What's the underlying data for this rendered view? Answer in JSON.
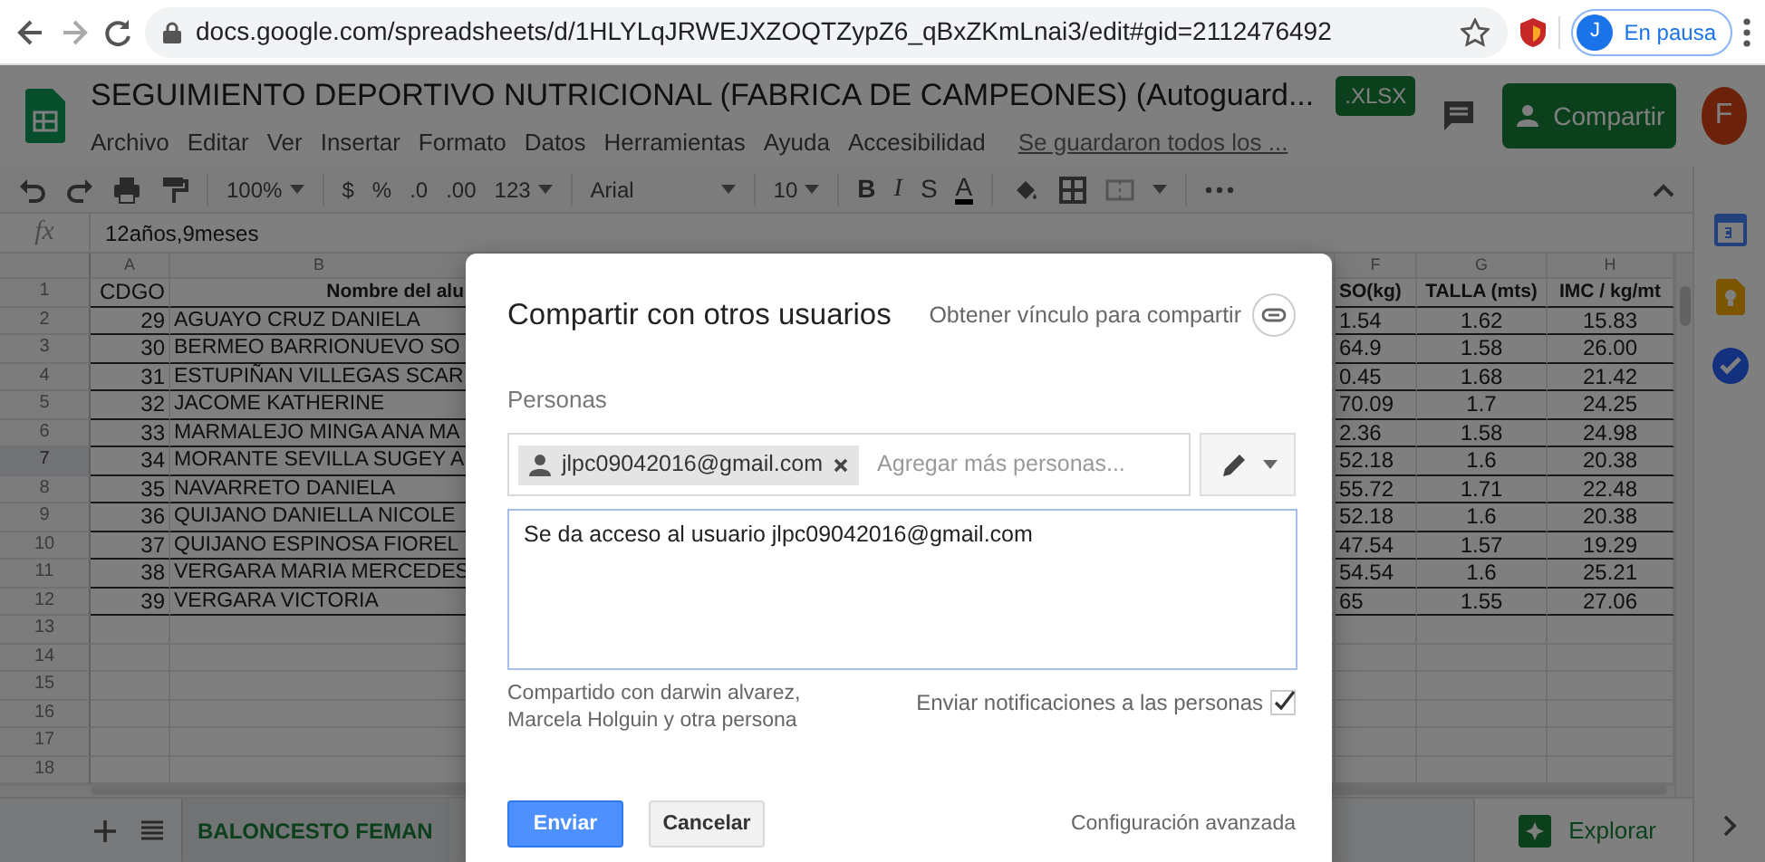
{
  "browser": {
    "address": "docs.google.com/spreadsheets/d/1HLYLqJRWEJXZOQTZypZ6_qBxZKmLnai3/edit#gid=2112476492",
    "profile_initial": "J",
    "profile_status": "En pausa"
  },
  "app": {
    "title": "SEGUIMIENTO DEPORTIVO NUTRICIONAL (FABRICA DE CAMPEONES) (Autoguard...",
    "file_badge": ".XLSX",
    "menu": [
      "Archivo",
      "Editar",
      "Ver",
      "Insertar",
      "Formato",
      "Datos",
      "Herramientas",
      "Ayuda",
      "Accesibilidad"
    ],
    "save_status": "Se guardaron todos los ...",
    "share_button": "Compartir",
    "avatar_initial": "F"
  },
  "toolbar": {
    "zoom": "100%",
    "currency": "$",
    "percent": "%",
    "decimals_less": ".0",
    "decimals_more": ".00",
    "number_format": "123",
    "font": "Arial",
    "font_size": "10",
    "bold": "B",
    "italic": "I",
    "strikethrough": "S",
    "text_color": "A"
  },
  "formula_bar": {
    "fx": "fx",
    "value": "12años,9meses"
  },
  "sheet": {
    "columns": [
      "A",
      "B",
      "F",
      "G",
      "H"
    ],
    "rows": [
      {
        "number": "1",
        "kind": "header",
        "selected": false,
        "cells": [
          "CDGO",
          "Nombre del alu",
          "SO(kg)",
          "TALLA (mts)",
          "IMC /  kg/mt"
        ]
      },
      {
        "number": "2",
        "kind": "data",
        "selected": false,
        "cells": [
          "29",
          "AGUAYO CRUZ DANIELA",
          "1.54",
          "1.62",
          "15.83"
        ]
      },
      {
        "number": "3",
        "kind": "data",
        "selected": false,
        "cells": [
          "30",
          "BERMEO BARRIONUEVO SO",
          "64.9",
          "1.58",
          "26.00"
        ]
      },
      {
        "number": "4",
        "kind": "data",
        "selected": false,
        "cells": [
          "31",
          "ESTUPIÑAN VILLEGAS SCAR",
          "0.45",
          "1.68",
          "21.42"
        ]
      },
      {
        "number": "5",
        "kind": "data",
        "selected": false,
        "cells": [
          "32",
          "JACOME KATHERINE",
          "70.09",
          "1.7",
          "24.25"
        ]
      },
      {
        "number": "6",
        "kind": "data",
        "selected": false,
        "cells": [
          "33",
          "MARMALEJO MINGA ANA MA",
          "2.36",
          "1.58",
          "24.98"
        ]
      },
      {
        "number": "7",
        "kind": "data",
        "selected": true,
        "cells": [
          "34",
          "MORANTE SEVILLA SUGEY A",
          "52.18",
          "1.6",
          "20.38"
        ]
      },
      {
        "number": "8",
        "kind": "data",
        "selected": false,
        "cells": [
          "35",
          "NAVARRETO DANIELA",
          "55.72",
          "1.71",
          "22.48"
        ]
      },
      {
        "number": "9",
        "kind": "data",
        "selected": false,
        "cells": [
          "36",
          "QUIJANO DANIELLA NICOLE",
          "52.18",
          "1.6",
          "20.38"
        ]
      },
      {
        "number": "10",
        "kind": "data",
        "selected": false,
        "cells": [
          "37",
          "QUIJANO ESPINOSA FIOREL",
          "47.54",
          "1.57",
          "19.29"
        ]
      },
      {
        "number": "11",
        "kind": "data",
        "selected": false,
        "cells": [
          "38",
          "VERGARA MARIA MERCEDES",
          "54.54",
          "1.6",
          "25.21"
        ]
      },
      {
        "number": "12",
        "kind": "data",
        "selected": false,
        "cells": [
          "39",
          "VERGARA VICTORIA",
          "65",
          "1.55",
          "27.06"
        ]
      },
      {
        "number": "13",
        "kind": "empty",
        "selected": false
      },
      {
        "number": "14",
        "kind": "empty",
        "selected": false
      },
      {
        "number": "15",
        "kind": "empty",
        "selected": false
      },
      {
        "number": "16",
        "kind": "empty",
        "selected": false
      },
      {
        "number": "17",
        "kind": "empty",
        "selected": false
      },
      {
        "number": "18",
        "kind": "empty",
        "selected": false
      }
    ],
    "tab": "BALONCESTO FEMAN",
    "explore": "Explorar"
  },
  "dialog": {
    "title": "Compartir con otros usuarios",
    "link": "Obtener vínculo para compartir",
    "section": "Personas",
    "chip": "jlpc09042016@gmail.com",
    "placeholder": "Agregar más personas...",
    "message": "Se da acceso al usuario jlpc09042016@gmail.com",
    "shared_with": "Compartido con darwin alvarez, Marcela Holguin y otra persona",
    "notify": {
      "label": "Enviar notificaciones a las personas",
      "checked": true
    },
    "send": "Enviar",
    "cancel": "Cancelar",
    "advanced": "Configuración avanzada"
  }
}
